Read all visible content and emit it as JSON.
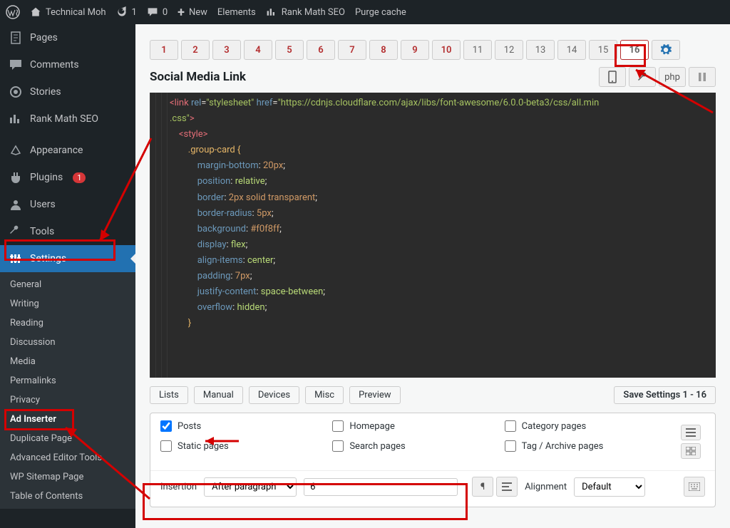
{
  "topbar": {
    "site_name": "Technical Moh",
    "refresh_count": "1",
    "comment_count": "0",
    "new_label": "New",
    "elements_label": "Elements",
    "rankmath_label": "Rank Math SEO",
    "purge_label": "Purge cache"
  },
  "sidebar": {
    "items": [
      {
        "label": "Pages",
        "icon": "page"
      },
      {
        "label": "Comments",
        "icon": "comment"
      },
      {
        "label": "Stories",
        "icon": "story"
      },
      {
        "label": "Rank Math SEO",
        "icon": "seo"
      },
      {
        "label": "Appearance",
        "icon": "appearance"
      },
      {
        "label": "Plugins",
        "icon": "plugin",
        "badge": "1"
      },
      {
        "label": "Users",
        "icon": "users"
      },
      {
        "label": "Tools",
        "icon": "tools"
      },
      {
        "label": "Settings",
        "icon": "settings",
        "active": true
      }
    ],
    "sub_items": [
      {
        "label": "General"
      },
      {
        "label": "Writing"
      },
      {
        "label": "Reading"
      },
      {
        "label": "Discussion"
      },
      {
        "label": "Media"
      },
      {
        "label": "Permalinks"
      },
      {
        "label": "Privacy"
      },
      {
        "label": "Ad Inserter",
        "current": true
      },
      {
        "label": "Duplicate Page"
      },
      {
        "label": "Advanced Editor Tools"
      },
      {
        "label": "WP Sitemap Page"
      },
      {
        "label": "Table of Contents"
      }
    ]
  },
  "tabs": {
    "count": 16,
    "used_through": 16,
    "active": 16
  },
  "block_title": "Social Media Link",
  "toolbar_icons": {
    "php": "php"
  },
  "opt_buttons": [
    "Lists",
    "Manual",
    "Devices",
    "Misc",
    "Preview"
  ],
  "save_label": "Save Settings 1 - 16",
  "checks": {
    "col1": [
      {
        "label": "Posts",
        "checked": true
      },
      {
        "label": "Static pages",
        "checked": false
      }
    ],
    "col2": [
      {
        "label": "Homepage",
        "checked": false
      },
      {
        "label": "Search pages",
        "checked": false
      }
    ],
    "col3": [
      {
        "label": "Category pages",
        "checked": false
      },
      {
        "label": "Tag / Archive pages",
        "checked": false
      }
    ]
  },
  "insertion": {
    "label": "Insertion",
    "select_value": "After paragraph",
    "number": "6",
    "align_label": "Alignment",
    "align_value": "Default"
  },
  "code": {
    "lines": [
      {
        "t": "tag_open",
        "raw": "<link rel=\"stylesheet\" href=\"https://cdnjs.cloudflare.com/ajax/libs/font-awesome/6.0.0-beta3/css/all.min.css\">"
      },
      {
        "t": "tag",
        "raw": "    <style>"
      },
      {
        "t": "sel",
        "raw": "        .group-card {"
      },
      {
        "t": "prop",
        "p": "margin-bottom",
        "v": "20px"
      },
      {
        "t": "prop",
        "p": "position",
        "v": "relative"
      },
      {
        "t": "prop",
        "p": "border",
        "v": "2px solid transparent"
      },
      {
        "t": "prop",
        "p": "border-radius",
        "v": "5px"
      },
      {
        "t": "prop",
        "p": "background",
        "v": "#f0f8ff"
      },
      {
        "t": "prop",
        "p": "display",
        "v": "flex"
      },
      {
        "t": "prop",
        "p": "align-items",
        "v": "center"
      },
      {
        "t": "prop",
        "p": "padding",
        "v": "7px"
      },
      {
        "t": "prop",
        "p": "justify-content",
        "v": "space-between"
      },
      {
        "t": "prop",
        "p": "overflow",
        "v": "hidden"
      },
      {
        "t": "brace",
        "raw": "        }"
      }
    ]
  }
}
